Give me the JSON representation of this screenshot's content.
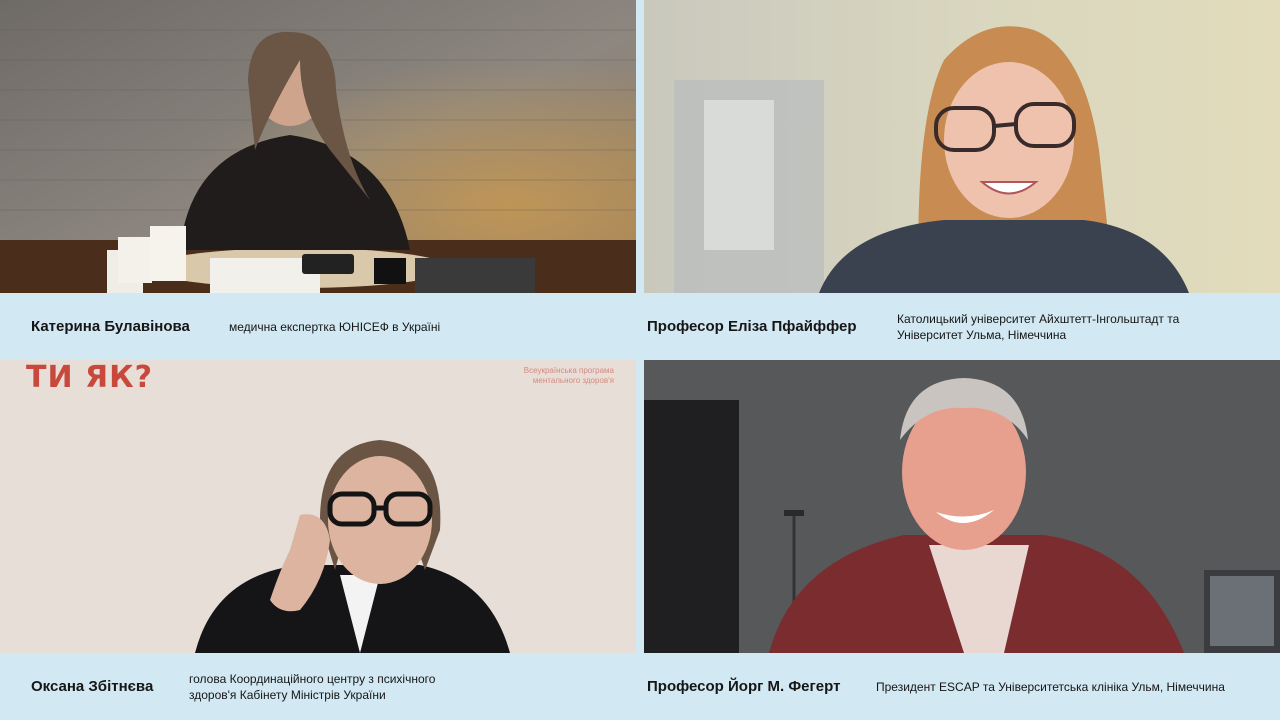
{
  "participants": [
    {
      "name": "Катерина Булавінова",
      "role": "медична експертка ЮНІСЕФ в Україні"
    },
    {
      "name": "Професор Еліза Пфайффер",
      "role": "Католицький університет Айхштетт-Інгольштадт та Університет Ульма, Німеччина"
    },
    {
      "name": "Оксана Збітнєва",
      "role": "голова Координаційного центру з психічного здоров'я Кабінету Міністрів України"
    },
    {
      "name": "Професор Йорг М. Фегерт",
      "role": "Президент ESCAP та Університетська клініка Ульм, Німеччина"
    }
  ],
  "backdrop": {
    "logo": "ТИ ЯК?",
    "program": "Всеукраїнська програма ментального здоров'я"
  },
  "colors": {
    "caption_bg": "#d2e8f2",
    "logo_red": "#c8483c"
  }
}
